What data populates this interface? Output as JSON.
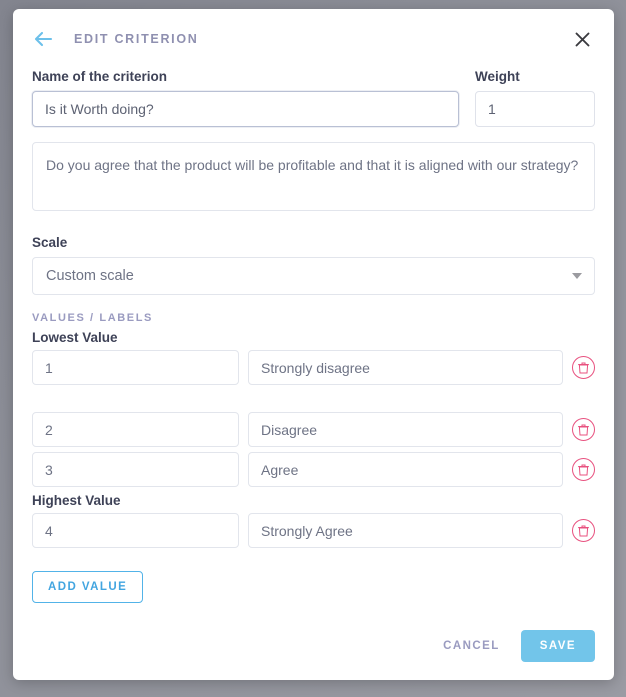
{
  "header": {
    "title": "EDIT CRITERION",
    "back_icon": "arrow-left-icon",
    "close_icon": "close-icon",
    "accent_color": "#6cc0ea",
    "title_color": "#8f90b0"
  },
  "form": {
    "name_label": "Name of the criterion",
    "name_value": "Is it Worth doing?",
    "weight_label": "Weight",
    "weight_value": "1",
    "description_value": "Do you agree that the product will be profitable and that it is aligned with our strategy?"
  },
  "scale": {
    "label": "Scale",
    "selected": "Custom scale",
    "caret_icon": "chevron-down-icon"
  },
  "values_section": {
    "caption": "VALUES / LABELS",
    "lowest_label": "Lowest Value",
    "highest_label": "Highest Value",
    "delete_icon": "trash-icon",
    "delete_color": "#e8517f",
    "rows": [
      {
        "value": "1",
        "label": "Strongly disagree"
      },
      {
        "value": "2",
        "label": "Disagree"
      },
      {
        "value": "3",
        "label": "Agree"
      },
      {
        "value": "4",
        "label": "Strongly Agree"
      }
    ]
  },
  "actions": {
    "add_value": "ADD VALUE",
    "cancel": "CANCEL",
    "save": "SAVE",
    "add_value_color": "#42a5e0",
    "save_bg": "#72c5ea"
  }
}
